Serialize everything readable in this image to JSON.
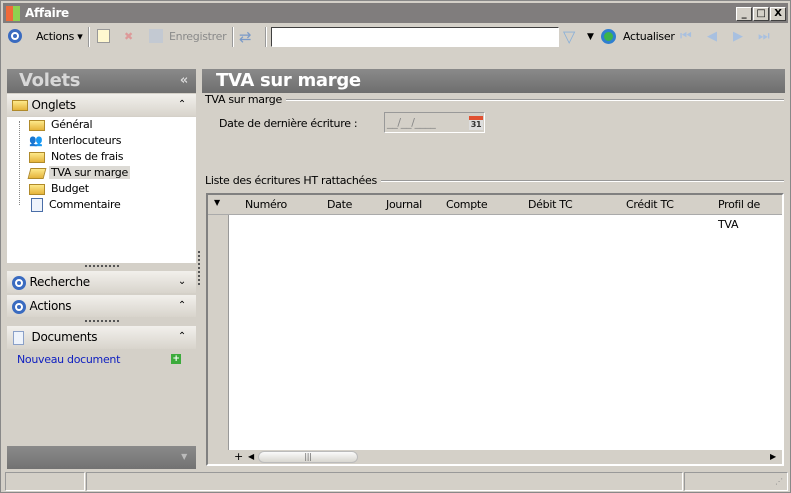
{
  "window": {
    "title": "Affaire",
    "minimize": "_",
    "maximize": "□",
    "close": "X"
  },
  "toolbar": {
    "actions_label": "Actions",
    "save_label": "Enregistrer",
    "search_value": "",
    "refresh_label": "Actualiser"
  },
  "sidebar": {
    "title": "Volets",
    "collapse": "«",
    "onglets": {
      "label": "Onglets",
      "items": [
        {
          "label": "Général",
          "icon": "folder-icon"
        },
        {
          "label": "Interlocuteurs",
          "icon": "users-icon"
        },
        {
          "label": "Notes de frais",
          "icon": "folder-icon"
        },
        {
          "label": "TVA sur marge",
          "icon": "folder-open-icon",
          "selected": true
        },
        {
          "label": "Budget",
          "icon": "folder-icon"
        },
        {
          "label": "Commentaire",
          "icon": "document-icon"
        }
      ]
    },
    "recherche": "Recherche",
    "actions": "Actions",
    "documents": "Documents",
    "new_document": "Nouveau document"
  },
  "main": {
    "title": "TVA sur marge",
    "group1": "TVA sur marge",
    "date_label": "Date de dernière écriture :",
    "date_value": "__/__/____",
    "calendar": "31",
    "group2": "Liste des écritures HT rattachées",
    "columns": [
      "Numéro",
      "Date",
      "Journal",
      "Compte",
      "Débit TC",
      "Crédit TC",
      "Profil de TVA"
    ],
    "add": "+"
  }
}
